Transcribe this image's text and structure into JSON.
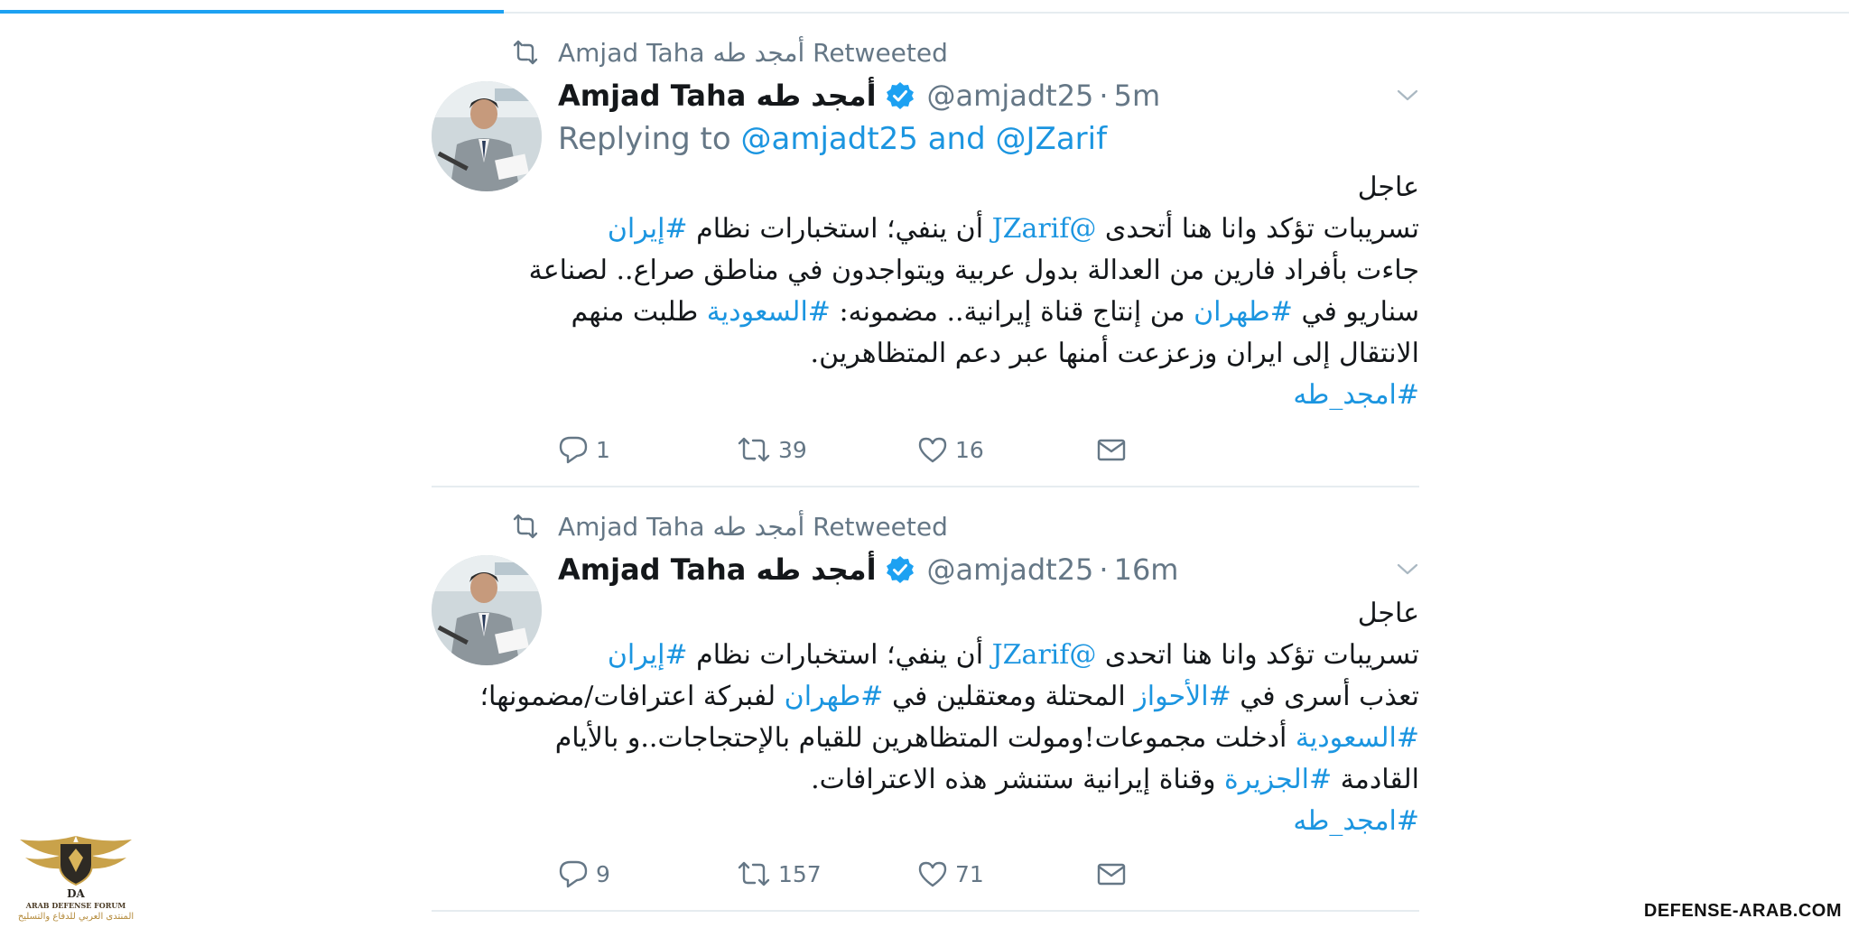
{
  "colors": {
    "accent": "#1da1f2",
    "link": "#1b95e0",
    "muted": "#657786",
    "verified": "#1da1f2"
  },
  "tweets": [
    {
      "retweeted_by": "Amjad Taha أمجد طه Retweeted",
      "author_name": "Amjad Taha أمجد طه",
      "handle": "@amjadt25",
      "separator": "·",
      "time": "5m",
      "replying_prefix": "Replying to",
      "replying_targets": "@amjadt25 and @JZarif",
      "lines": [
        [
          {
            "t": "عاجل"
          }
        ],
        [
          {
            "t": "تسريبات تؤكد وانا هنا أتحدى "
          },
          {
            "t": "@JZarif",
            "hl": true
          },
          {
            "t": " أن ينفي؛ استخبارات نظام "
          },
          {
            "t": "#إيران",
            "hl": true
          }
        ],
        [
          {
            "t": "جاءت بأفراد فارين من العدالة بدول عربية ويتواجدون في مناطق صراع.. لصناعة"
          }
        ],
        [
          {
            "t": "سناريو في "
          },
          {
            "t": "#طهران",
            "hl": true
          },
          {
            "t": " من إنتاج قناة إيرانية.. مضمونه: "
          },
          {
            "t": "#السعودية",
            "hl": true
          },
          {
            "t": " طلبت منهم"
          }
        ],
        [
          {
            "t": "الانتقال إلى ايران وزعزعت أمنها عبر دعم المتظاهرين."
          }
        ],
        [
          {
            "t": "#امجد_طه",
            "hl": true
          }
        ]
      ],
      "stats": {
        "replies": "1",
        "retweets": "39",
        "likes": "16"
      }
    },
    {
      "retweeted_by": "Amjad Taha أمجد طه Retweeted",
      "author_name": "Amjad Taha أمجد طه",
      "handle": "@amjadt25",
      "separator": "·",
      "time": "16m",
      "lines": [
        [
          {
            "t": "عاجل"
          }
        ],
        [
          {
            "t": "تسريبات تؤكد وانا هنا اتحدى "
          },
          {
            "t": "@JZarif",
            "hl": true
          },
          {
            "t": " أن ينفي؛ استخبارات نظام "
          },
          {
            "t": "#إيران",
            "hl": true
          }
        ],
        [
          {
            "t": "تعذب أسرى في "
          },
          {
            "t": "#الأحواز",
            "hl": true
          },
          {
            "t": " المحتلة ومعتقلين في "
          },
          {
            "t": "#طهران",
            "hl": true
          },
          {
            "t": " لفبركة اعترافات/مضمونها؛"
          }
        ],
        [
          {
            "t": "#السعودية",
            "hl": true
          },
          {
            "t": " أدخلت مجموعات!ومولت المتظاهرين للقيام بالإحتجاجات..و بالأيام"
          }
        ],
        [
          {
            "t": "القادمة "
          },
          {
            "t": "#الجزيرة",
            "hl": true
          },
          {
            "t": " وقناة إيرانية ستنشر هذه الاعترافات."
          }
        ],
        [
          {
            "t": "#امجد_طه",
            "hl": true
          }
        ]
      ],
      "stats": {
        "replies": "9",
        "retweets": "157",
        "likes": "71"
      }
    }
  ],
  "icons": [
    "retweet-icon",
    "verified-badge-icon",
    "chevron-down-icon",
    "reply-icon",
    "like-icon",
    "direct-message-icon"
  ],
  "logo": {
    "title": "ARAB DEFENSE FORUM",
    "subtitle": "المنتدى العربي للدفاع والتسليح",
    "initials": "DA"
  },
  "watermark": "DEFENSE-ARAB.COM"
}
